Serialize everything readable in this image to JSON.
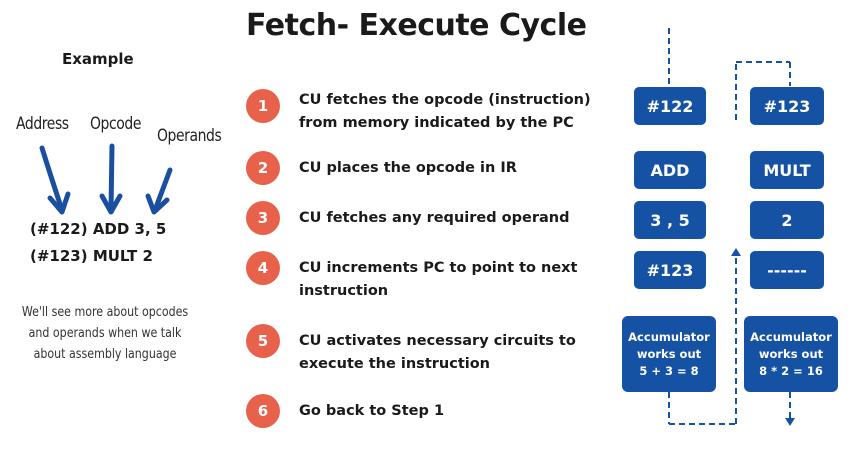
{
  "title": "Fetch- Execute Cycle",
  "example": {
    "heading": "Example",
    "labels": {
      "address": "Address",
      "opcode": "Opcode",
      "operands": "Operands"
    },
    "code_lines": [
      "(#122) ADD 3, 5",
      "(#123) MULT 2"
    ],
    "note": "We'll see more about opcodes and operands when we talk about assembly language"
  },
  "steps": [
    {
      "number": "1",
      "text": "CU fetches the opcode (instruction) from memory indicated by the PC"
    },
    {
      "number": "2",
      "text": "CU places the opcode in IR"
    },
    {
      "number": "3",
      "text": "CU fetches any required operand"
    },
    {
      "number": "4",
      "text": "CU increments PC to point to next instruction"
    },
    {
      "number": "5",
      "text": "CU activates necessary circuits to execute the instruction"
    },
    {
      "number": "6",
      "text": "Go back to Step 1"
    }
  ],
  "column1": {
    "address": "#122",
    "opcode": "ADD",
    "operands": "3 , 5",
    "next_pc": "#123",
    "acc_line1": "Accumulator",
    "acc_line2": "works out",
    "acc_line3": "5 + 3 = 8"
  },
  "column2": {
    "address": "#123",
    "opcode": "MULT",
    "operands": "2",
    "next_pc": "------",
    "acc_line1": "Accumulator",
    "acc_line2": "works out",
    "acc_line3": "8 * 2 = 16"
  },
  "colors": {
    "step_circle": "#e8624b",
    "box_fill": "#1552a4",
    "arrow_blue": "#1a4fa0",
    "dashed_line": "#1552a4"
  },
  "icons": {
    "example_arrows": "down-arrow-icon",
    "flow_arrows": "dashed-arrow-icon"
  }
}
